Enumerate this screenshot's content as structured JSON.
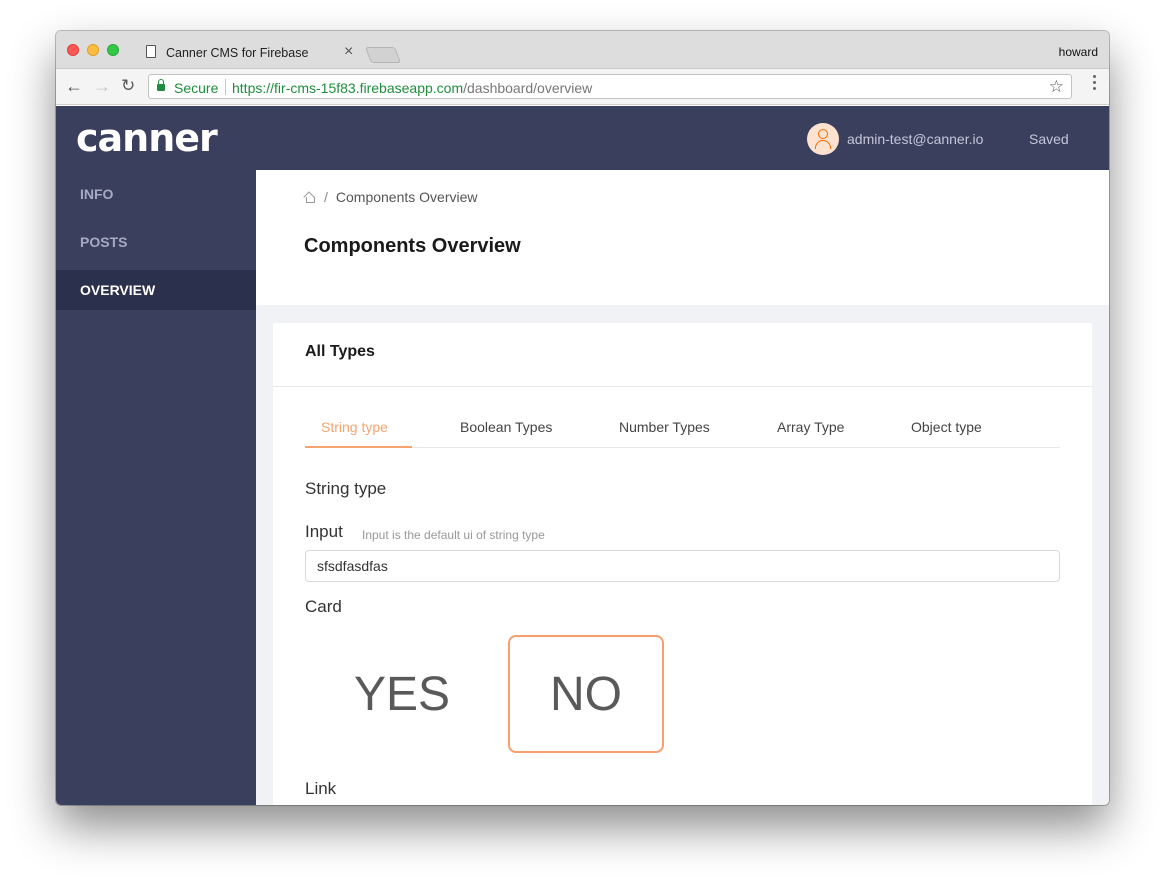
{
  "browser": {
    "tab_title": "Canner CMS for Firebase",
    "profile_name": "howard",
    "secure_label": "Secure",
    "url_scheme": "https://",
    "url_host": "fir-cms-15f83.firebaseapp.com",
    "url_path": "/dashboard/overview",
    "icons": [
      "back-arrow-icon",
      "forward-arrow-icon",
      "reload-icon",
      "lock-icon",
      "star-icon",
      "menu-icon",
      "document-icon",
      "close-icon"
    ]
  },
  "header": {
    "logo": "canner",
    "user_email": "admin-test@canner.io",
    "status": "Saved",
    "avatar_colors": {
      "bg": "#fde3cf",
      "fg": "#f56a00"
    }
  },
  "sidebar": {
    "items": [
      {
        "label": "INFO",
        "active": false
      },
      {
        "label": "POSTS",
        "active": false
      },
      {
        "label": "OVERVIEW",
        "active": true
      }
    ]
  },
  "page": {
    "breadcrumb": {
      "separator": "/",
      "current": "Components Overview"
    },
    "title": "Components Overview"
  },
  "card": {
    "title": "All Types",
    "tabs": [
      {
        "label": "String type",
        "active": true
      },
      {
        "label": "Boolean Types",
        "active": false
      },
      {
        "label": "Number Types",
        "active": false
      },
      {
        "label": "Array Type",
        "active": false
      },
      {
        "label": "Object type",
        "active": false
      }
    ],
    "section_title": "String type",
    "input_field": {
      "label": "Input",
      "hint": "Input is the default ui of string type",
      "value": "sfsdfasdfas"
    },
    "card_field": {
      "label": "Card",
      "options": [
        {
          "label": "YES",
          "selected": false
        },
        {
          "label": "NO",
          "selected": true
        }
      ]
    },
    "link_label": "Link"
  },
  "colors": {
    "header_bg": "#3a3f5e",
    "sidebar_active_bg": "#2b304c",
    "accent": "#f5a46f",
    "selected_border": "#fa9e70"
  }
}
